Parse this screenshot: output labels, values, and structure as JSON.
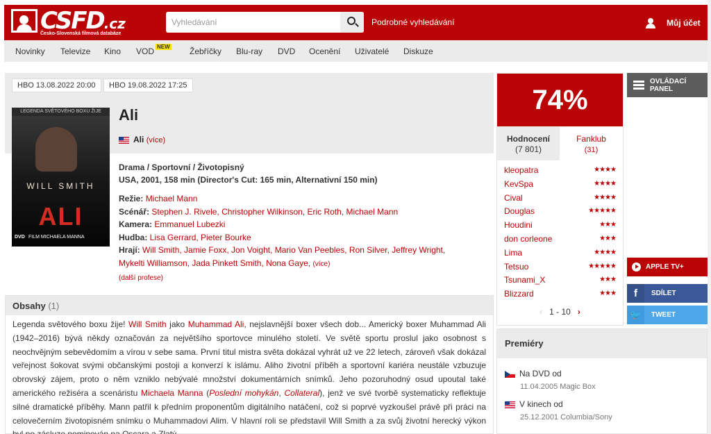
{
  "header": {
    "logo_text": "CSFD",
    "logo_tld": ".cz",
    "logo_subtitle": "Česko-Slovenská filmová databáze",
    "search_placeholder": "Vyhledávání",
    "advanced_search": "Podrobné vyhledávání",
    "account": "Můj účet"
  },
  "nav": {
    "items": [
      "Novinky",
      "Televize",
      "Kino",
      "VOD",
      "Žebříčky",
      "Blu-ray",
      "DVD",
      "Ocenění",
      "Uživatelé",
      "Diskuze"
    ],
    "vod_badge": "NEW"
  },
  "tv_tags": [
    "HBO 13.08.2022 20:00",
    "HBO 19.08.2022 17:25"
  ],
  "poster": {
    "top_text": "LEGENDA SVĚTOVÉHO BOXU ŽIJE",
    "actor_text": "WILL   SMITH",
    "title_text": "ALI",
    "badge": "DVD",
    "credit": "FILM MICHAELA MANNA"
  },
  "film": {
    "title": "Ali",
    "alt_title": "Ali",
    "alt_more": "(více)",
    "genres": "Drama / Sportovní / Životopisný",
    "origin": "USA, 2001, 158 min (Director's Cut: 165 min, Alternativní 150 min)",
    "directing_label": "Režie:",
    "directing": "Michael Mann",
    "writing_label": "Scénář:",
    "writing": "Stephen J. Rivele, Christopher Wilkinson, Eric Roth, Michael Mann",
    "camera_label": "Kamera:",
    "camera": "Emmanuel Lubezki",
    "music_label": "Hudba:",
    "music": "Lisa Gerrard, Pieter Bourke",
    "cast_label": "Hrají:",
    "cast_line1": "Will Smith, Jamie Foxx, Jon Voight, Mario Van Peebles, Ron Silver, Jeffrey Wright,",
    "cast_line2": "Mykelti Williamson, Jada Pinkett Smith, Nona Gaye,",
    "cast_more": "(více)",
    "more_professions": "(další profese)"
  },
  "obsahy": {
    "title": "Obsahy",
    "count": "(1)",
    "p1": "Legenda světového boxu žije! ",
    "l1": "Will Smith",
    "p2": " jako ",
    "l2": "Muhammad Ali",
    "p3": ", nejslavnější boxer všech dob... Americký boxer Muhammad Ali (1942–2016) bývá někdy označován za největšího sportovce minulého století. Ve světě sportu proslul jako osobnost s neochvějným sebevědomím a vírou v sebe sama. První titul mistra světa dokázal vyhrát už ve 22 letech, zároveň však dokázal veřejnost šokovat svými občanskými postoji a konverzí k islámu. Aliho životní příběh a sportovní kariéra neustále vzbuzuje obrovský zájem, proto o něm vzniklo nebývalé množství dokumentárních snímků. Jeho pozoruhodný osud upoutal také amerického režiséra a scenáristu ",
    "l3": "Michaela Manna",
    "p4": " (",
    "i1": "Poslední mohykán",
    "p5": ", ",
    "i2": "Collateral",
    "p6": "), jenž ve své tvorbě systematicky reflektuje silné dramatické příběhy. Mann patřil k předním proponentům digitálního natáčení, což si poprvé vyzkoušel právě při práci na celovečerním životopisném snímku o Muhammadovi Alim. V hlavní roli se představil Will Smith a za svůj životní herecký výkon byl po zásluze nominován na Oscara a Zlatý"
  },
  "rating": {
    "percent": "74%",
    "tab_ratings": "Hodnocení",
    "tab_ratings_count": "(7 801)",
    "tab_fanclub": "Fanklub",
    "tab_fanclub_count": "(31)",
    "users": [
      {
        "name": "kleopatra",
        "stars": 4
      },
      {
        "name": "KevSpa",
        "stars": 4
      },
      {
        "name": "Cival",
        "stars": 4
      },
      {
        "name": "Douglas",
        "stars": 5
      },
      {
        "name": "Houdini",
        "stars": 3
      },
      {
        "name": "don corleone",
        "stars": 3
      },
      {
        "name": "Lima",
        "stars": 4
      },
      {
        "name": "Tetsuo",
        "stars": 5
      },
      {
        "name": "Tsunami_X",
        "stars": 3
      },
      {
        "name": "Blizzard",
        "stars": 3
      }
    ],
    "pager": "1 - 10"
  },
  "sidebar": {
    "panel_button": "OVLÁDACÍ PANEL",
    "appletv": "APPLE TV+",
    "share": "SDÍLET",
    "tweet": "TWEET",
    "facebook_icon": "f"
  },
  "premiery": {
    "title": "Premiéry",
    "items": [
      {
        "type": "Na DVD od",
        "date": "11.04.2005 Magic Box",
        "flag": "cz"
      },
      {
        "type": "V kinech od",
        "date": "25.12.2001 Columbia/Sony",
        "flag": "us"
      }
    ]
  },
  "colors": {
    "brand_red": "#ba0305",
    "facebook": "#3b5998",
    "twitter": "#4ea7e8"
  }
}
